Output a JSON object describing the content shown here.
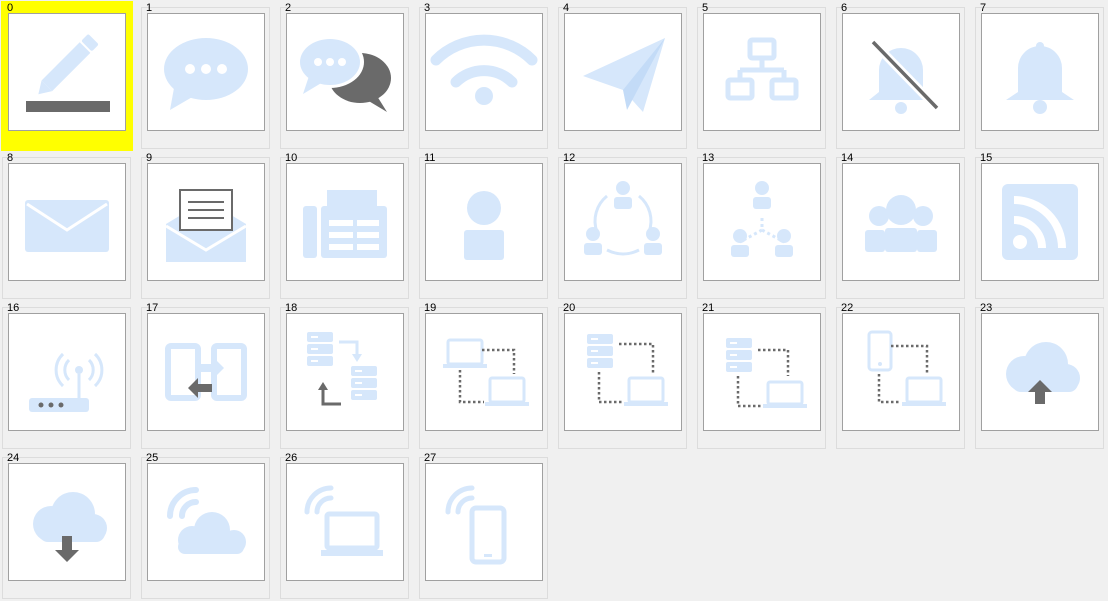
{
  "colors": {
    "icon_light": "#d6e7fb",
    "icon_dark": "#6a6a6a",
    "selection": "#ffff00",
    "background": "#f0f0f0"
  },
  "selected_index": 0,
  "items": [
    {
      "label": "0",
      "icon": "edit-pencil-icon"
    },
    {
      "label": "1",
      "icon": "chat-bubble-icon"
    },
    {
      "label": "2",
      "icon": "conversation-icon"
    },
    {
      "label": "3",
      "icon": "wifi-icon"
    },
    {
      "label": "4",
      "icon": "paper-plane-icon"
    },
    {
      "label": "5",
      "icon": "network-topology-icon"
    },
    {
      "label": "6",
      "icon": "bell-muted-icon"
    },
    {
      "label": "7",
      "icon": "bell-icon"
    },
    {
      "label": "8",
      "icon": "envelope-icon"
    },
    {
      "label": "9",
      "icon": "open-envelope-letter-icon"
    },
    {
      "label": "10",
      "icon": "fax-icon"
    },
    {
      "label": "11",
      "icon": "user-icon"
    },
    {
      "label": "12",
      "icon": "user-cycle-icon"
    },
    {
      "label": "13",
      "icon": "user-hierarchy-icon"
    },
    {
      "label": "14",
      "icon": "user-group-icon"
    },
    {
      "label": "15",
      "icon": "rss-icon"
    },
    {
      "label": "16",
      "icon": "wireless-router-icon"
    },
    {
      "label": "17",
      "icon": "tablet-sync-icon"
    },
    {
      "label": "18",
      "icon": "server-transfer-icon"
    },
    {
      "label": "19",
      "icon": "laptop-link-icon"
    },
    {
      "label": "20",
      "icon": "server-laptop-link-icon"
    },
    {
      "label": "21",
      "icon": "server-laptop-link-alt-icon"
    },
    {
      "label": "22",
      "icon": "phone-laptop-link-icon"
    },
    {
      "label": "23",
      "icon": "cloud-upload-icon"
    },
    {
      "label": "24",
      "icon": "cloud-download-icon"
    },
    {
      "label": "25",
      "icon": "wireless-cloud-icon"
    },
    {
      "label": "26",
      "icon": "wireless-laptop-icon"
    },
    {
      "label": "27",
      "icon": "wireless-phone-icon"
    }
  ]
}
